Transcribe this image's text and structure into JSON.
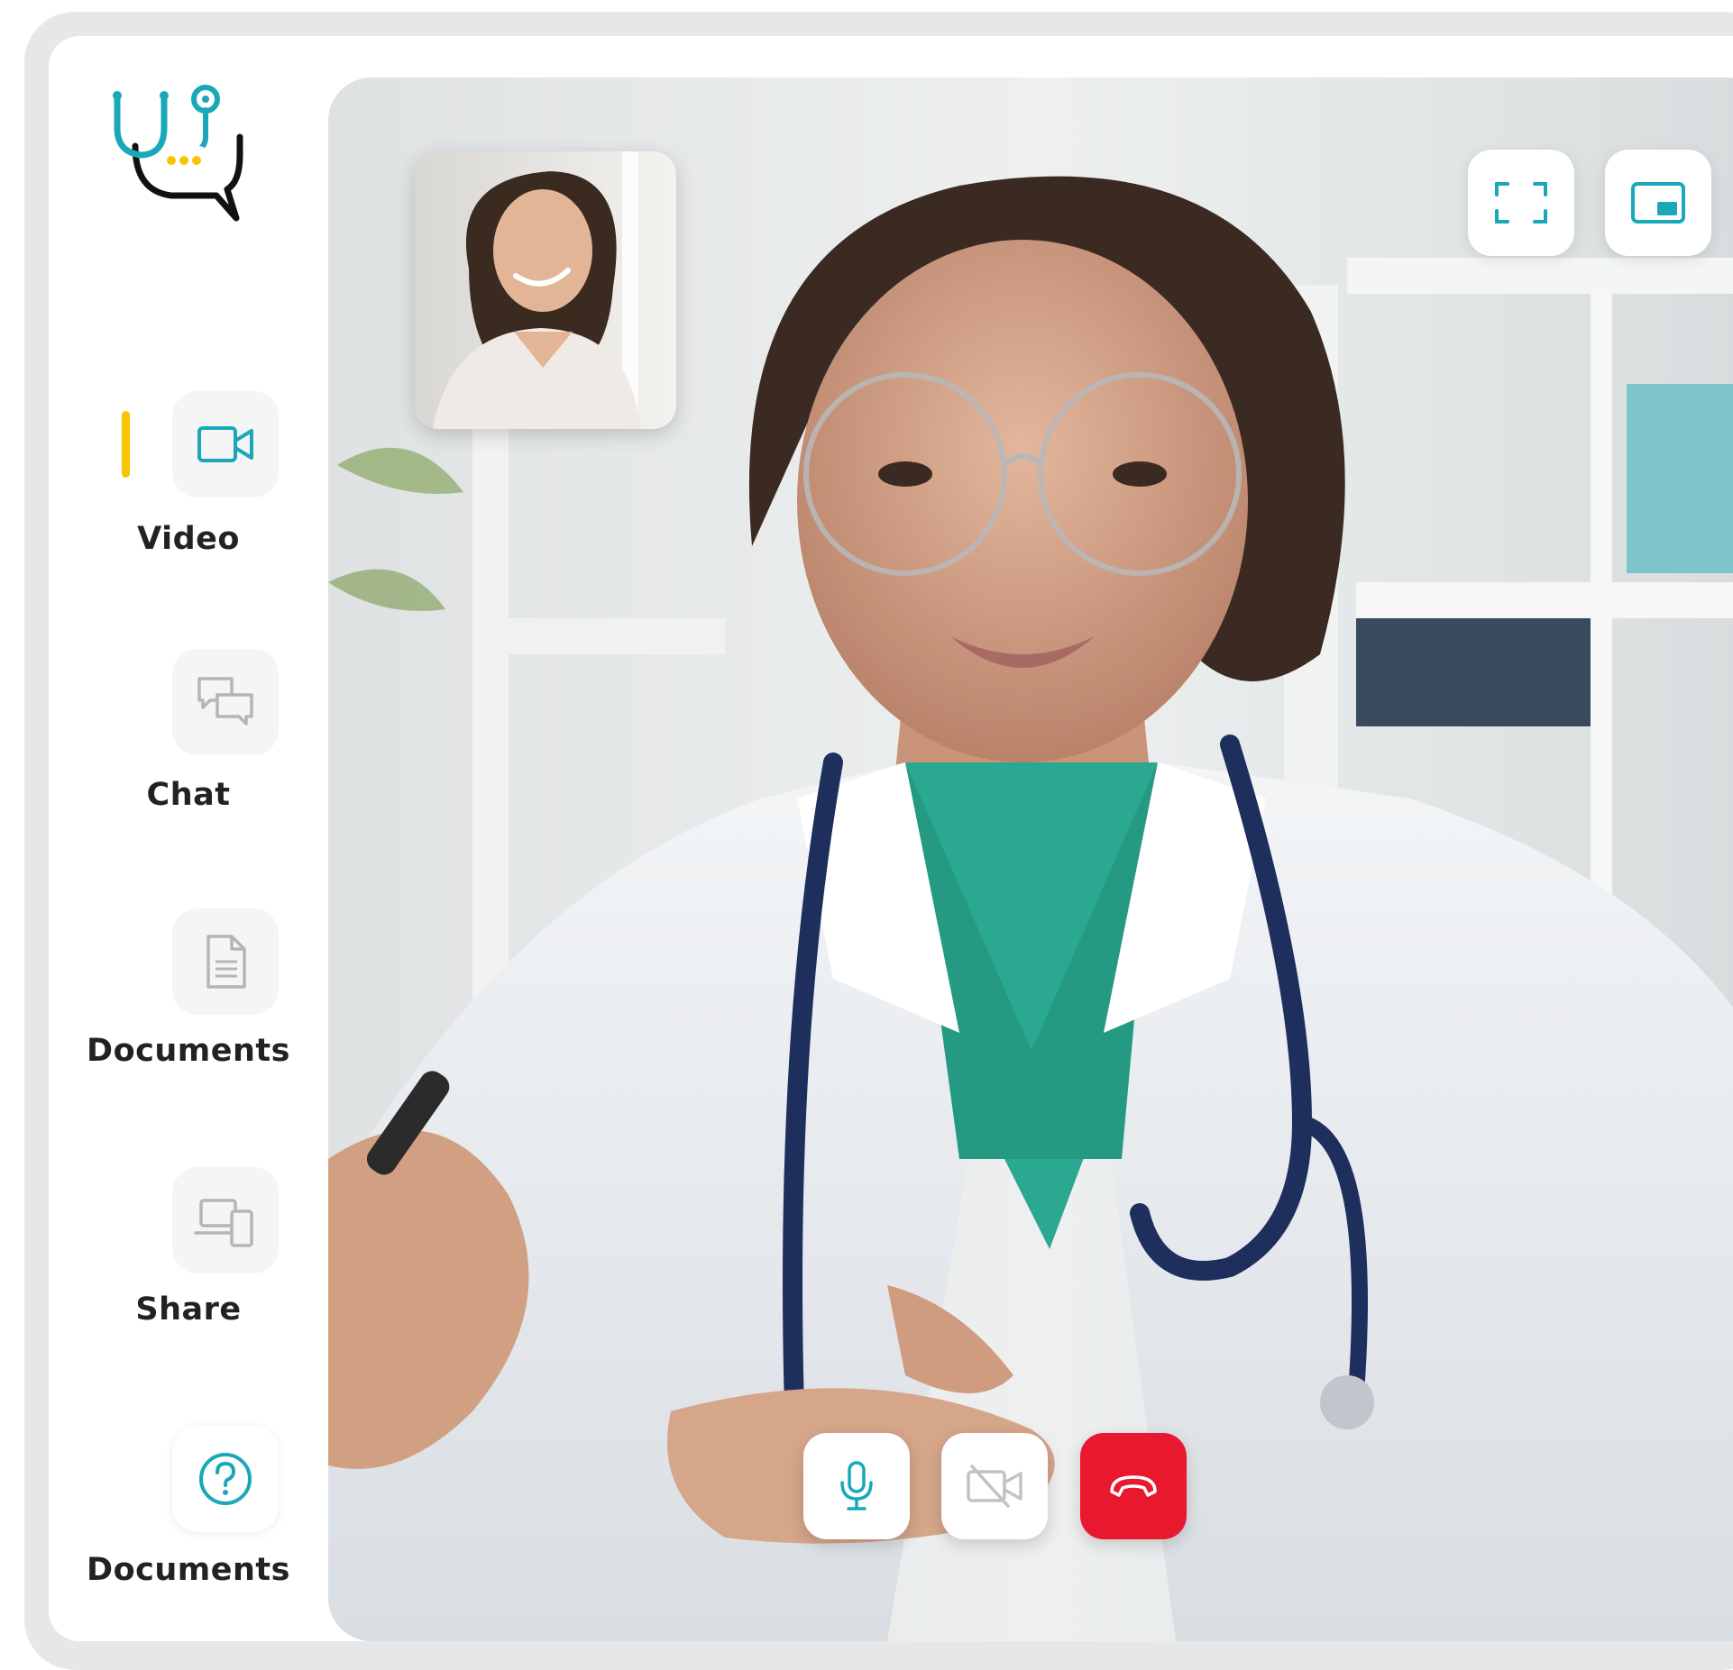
{
  "app": {
    "brand_accent": "#1aa8b8",
    "active_indicator_color": "#f6c400",
    "end_call_color": "#e8192f",
    "logo_icon": "stethoscope-chat-logo-icon"
  },
  "sidebar": {
    "items": [
      {
        "label": "Video",
        "icon": "video-camera-icon",
        "active": true
      },
      {
        "label": "Chat",
        "icon": "chat-bubbles-icon",
        "active": false
      },
      {
        "label": "Documents",
        "icon": "document-icon",
        "active": false
      },
      {
        "label": "Share",
        "icon": "devices-share-icon",
        "active": false
      },
      {
        "label": "Documents",
        "icon": "help-circle-icon",
        "active": false
      }
    ]
  },
  "video": {
    "main_feed": "doctor-video-feed",
    "self_view": "patient-self-view",
    "top_controls": [
      {
        "icon": "fullscreen-icon"
      },
      {
        "icon": "picture-in-picture-icon"
      }
    ],
    "call_controls": [
      {
        "icon": "microphone-icon",
        "state": "on"
      },
      {
        "icon": "camera-off-icon",
        "state": "off"
      },
      {
        "icon": "hang-up-icon",
        "state": "end-call"
      }
    ]
  }
}
